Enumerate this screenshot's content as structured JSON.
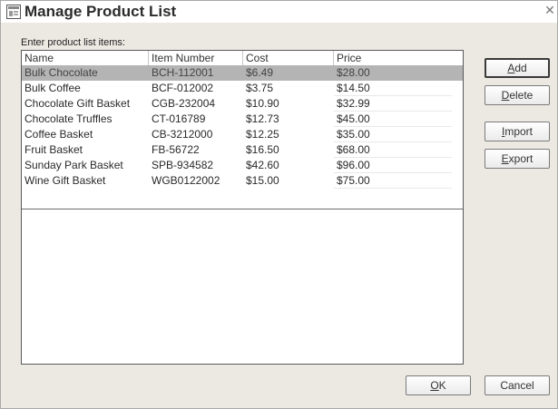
{
  "window": {
    "title": "Manage Product List",
    "close_glyph": "✕",
    "icon": "app-window-icon"
  },
  "prompt": {
    "label": "Enter product list items:"
  },
  "table": {
    "columns": [
      "Name",
      "Item Number",
      "Cost",
      "Price"
    ],
    "rows": [
      {
        "name": "Bulk Chocolate",
        "item": "BCH-112001",
        "cost": "$6.49",
        "price": "$28.00",
        "selected": true
      },
      {
        "name": "Bulk Coffee",
        "item": "BCF-012002",
        "cost": "$3.75",
        "price": "$14.50",
        "selected": false
      },
      {
        "name": "Chocolate Gift Basket",
        "item": "CGB-232004",
        "cost": "$10.90",
        "price": "$32.99",
        "selected": false
      },
      {
        "name": "Chocolate Truffles",
        "item": "CT-016789",
        "cost": "$12.73",
        "price": "$45.00",
        "selected": false
      },
      {
        "name": "Coffee Basket",
        "item": "CB-3212000",
        "cost": "$12.25",
        "price": "$35.00",
        "selected": false
      },
      {
        "name": "Fruit Basket",
        "item": "FB-56722",
        "cost": "$16.50",
        "price": "$68.00",
        "selected": false
      },
      {
        "name": "Sunday Park Basket",
        "item": "SPB-934582",
        "cost": "$42.60",
        "price": "$96.00",
        "selected": false
      },
      {
        "name": "Wine Gift Basket",
        "item": "WGB0122002",
        "cost": "$15.00",
        "price": "$75.00",
        "selected": false
      }
    ]
  },
  "buttons": {
    "add": {
      "pre": "",
      "u": "A",
      "post": "dd"
    },
    "delete": {
      "pre": "",
      "u": "D",
      "post": "elete"
    },
    "import": {
      "pre": "",
      "u": "I",
      "post": "mport"
    },
    "export": {
      "pre": "",
      "u": "E",
      "post": "xport"
    },
    "ok": {
      "pre": "",
      "u": "O",
      "post": "K"
    },
    "cancel": {
      "pre": "Cancel",
      "u": "",
      "post": ""
    }
  },
  "colors": {
    "selection": "#b4b4b4",
    "window_bg": "#ece9e3"
  }
}
